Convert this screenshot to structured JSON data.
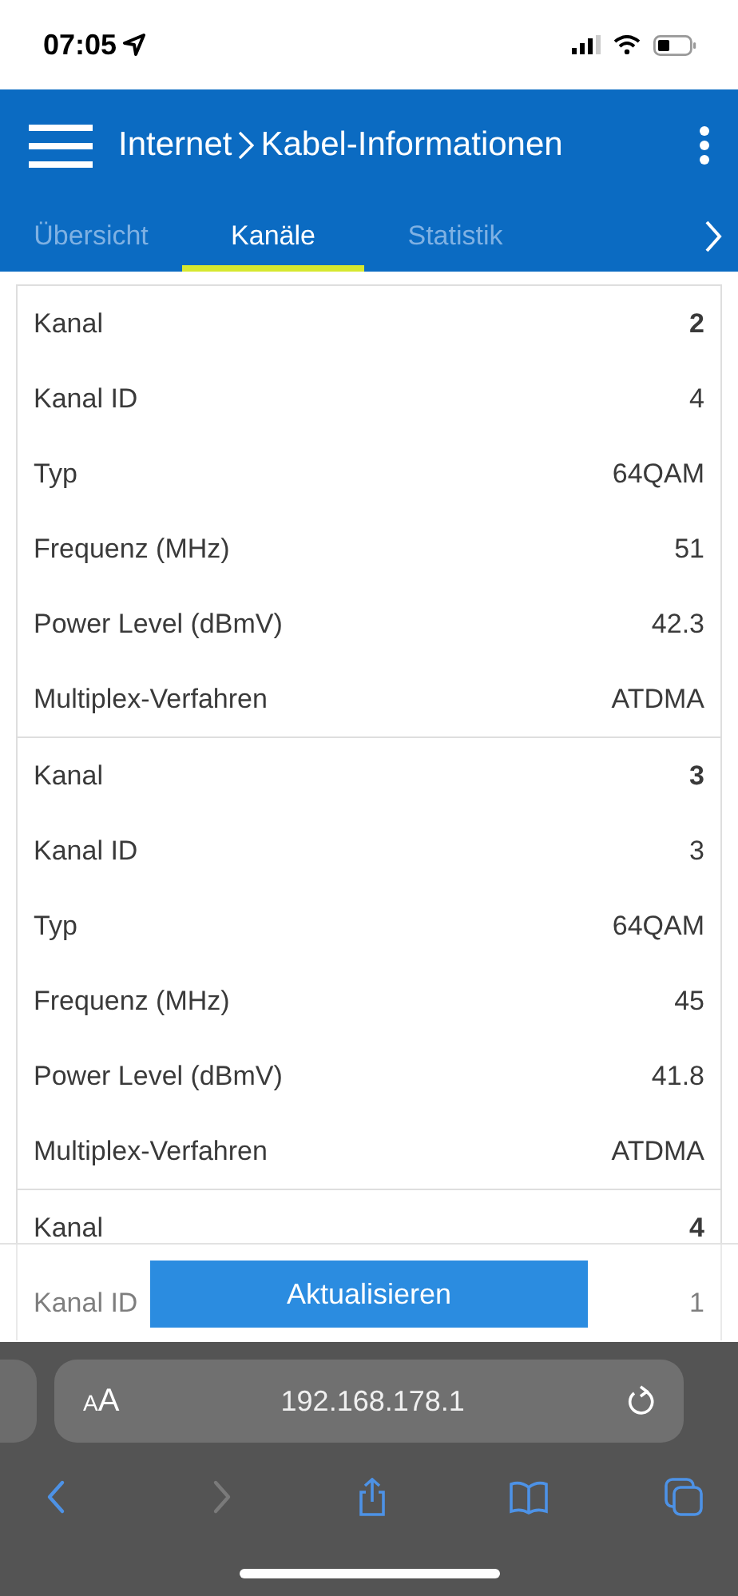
{
  "status_bar": {
    "time": "07:05"
  },
  "header": {
    "breadcrumb": [
      "Internet",
      "Kabel-Informationen"
    ]
  },
  "tabs": [
    {
      "label": "Übersicht",
      "selected": false
    },
    {
      "label": "Kanäle",
      "selected": true
    },
    {
      "label": "Statistik",
      "selected": false
    }
  ],
  "channels": [
    {
      "rows": [
        {
          "kind": "channel",
          "label": "Kanal",
          "value": "2"
        },
        {
          "kind": "field",
          "label": "Kanal ID",
          "value": "4"
        },
        {
          "kind": "field",
          "label": "Typ",
          "value": "64QAM"
        },
        {
          "kind": "field",
          "label": "Frequenz (MHz)",
          "value": "51"
        },
        {
          "kind": "field",
          "label": "Power Level (dBmV)",
          "value": "42.3"
        },
        {
          "kind": "field",
          "label": "Multiplex-Verfahren",
          "value": "ATDMA"
        }
      ]
    },
    {
      "rows": [
        {
          "kind": "channel",
          "label": "Kanal",
          "value": "3"
        },
        {
          "kind": "field",
          "label": "Kanal ID",
          "value": "3"
        },
        {
          "kind": "field",
          "label": "Typ",
          "value": "64QAM"
        },
        {
          "kind": "field",
          "label": "Frequenz (MHz)",
          "value": "45"
        },
        {
          "kind": "field",
          "label": "Power Level (dBmV)",
          "value": "41.8"
        },
        {
          "kind": "field",
          "label": "Multiplex-Verfahren",
          "value": "ATDMA"
        }
      ]
    },
    {
      "rows": [
        {
          "kind": "channel",
          "label": "Kanal",
          "value": "4"
        },
        {
          "kind": "field",
          "label": "Kanal ID",
          "value": "1"
        }
      ]
    }
  ],
  "refresh_button": "Aktualisieren",
  "browser": {
    "text_size": "AA",
    "url": "192.168.178.1",
    "toolbar": [
      {
        "kind": "back",
        "disabled": false
      },
      {
        "kind": "forward",
        "disabled": true
      },
      {
        "kind": "share",
        "disabled": false
      },
      {
        "kind": "bookmarks",
        "disabled": false
      },
      {
        "kind": "tabs",
        "disabled": false
      }
    ]
  }
}
